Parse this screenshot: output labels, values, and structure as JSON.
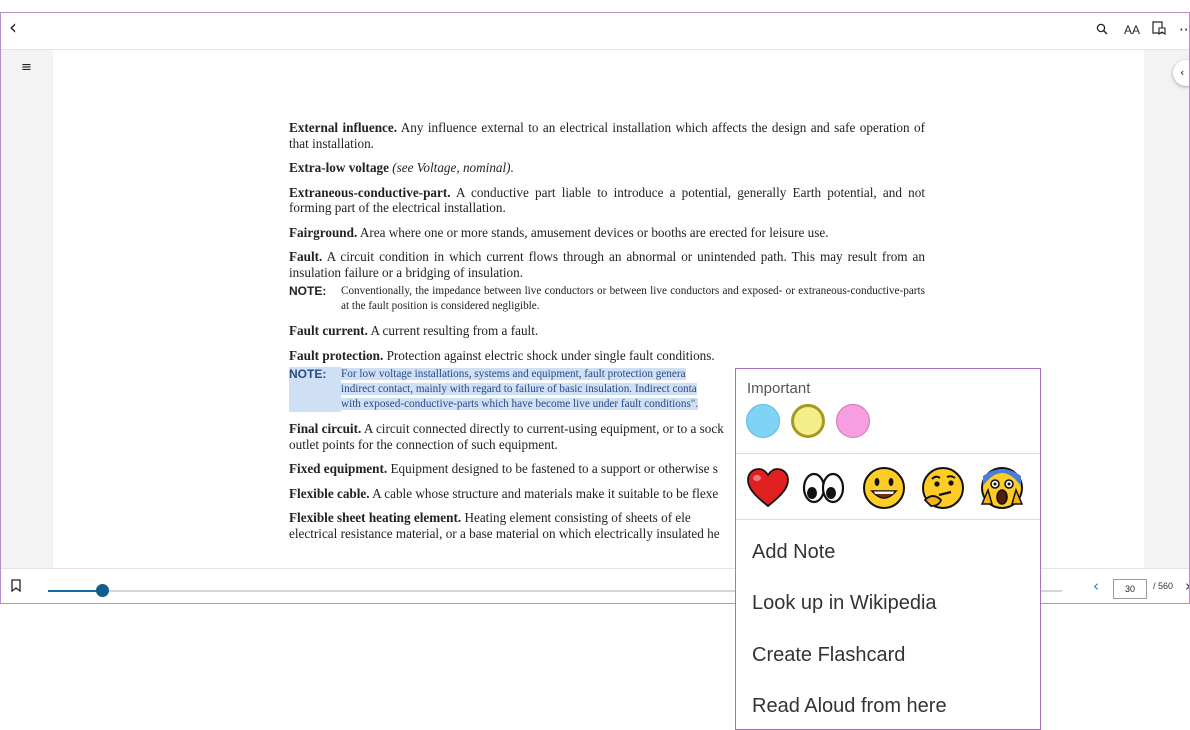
{
  "toolbar": {
    "back_icon": "‹",
    "search_icon": "⌕",
    "text_size_label": "AA",
    "more_icon": "··"
  },
  "sidebar": {
    "toc_icon": "≡"
  },
  "document": {
    "entries": [
      {
        "term": "External influence.",
        "text": " Any influence external to an electrical installation which affects the design and safe operation of that installation."
      },
      {
        "term": "Extra-low voltage",
        "see": " (see Voltage, nominal)."
      },
      {
        "term": "Extraneous-conductive-part.",
        "text": " A conductive part liable to introduce a potential, generally Earth potential, and not forming part of the electrical installation."
      },
      {
        "term": "Fairground.",
        "text": " Area where one or more stands, amusement devices or booths are erected for leisure use."
      },
      {
        "term": "Fault.",
        "text": " A circuit condition in which current flows through an abnormal or unintended path. This may result from an insulation failure or a bridging of insulation."
      },
      {
        "note_label": "NOTE:",
        "note_text": "Conventionally, the impedance between live conductors or between live conductors and exposed- or extraneous-conductive-parts at the fault position is considered negligible."
      },
      {
        "term": "Fault current.",
        "text": " A current resulting from a fault."
      },
      {
        "term": "Fault protection.",
        "text": " Protection against electric shock under single fault conditions."
      },
      {
        "note_label": "NOTE:",
        "note_lines": [
          "For low voltage installations, systems and equipment, fault protection genera",
          "indirect contact, mainly with regard to failure of basic insulation. Indirect conta",
          "with exposed-conductive-parts which have become live under fault conditions\"."
        ]
      },
      {
        "term": "Final circuit.",
        "text": " A circuit connected directly to current-using equipment, or to a sock",
        "text2": "outlet points for the connection of such equipment."
      },
      {
        "term": "Fixed equipment.",
        "text": " Equipment designed to be fastened to a support or otherwise s"
      },
      {
        "term": "Flexible cable.",
        "text": " A cable whose structure and materials make it suitable to be flexe"
      },
      {
        "term": "Flexible sheet heating element.",
        "text": " Heating element consisting of sheets of ele",
        "text2": "electrical resistance material, or a base material on which electrically insulated he"
      }
    ]
  },
  "bottom_bar": {
    "progress": 0.053,
    "current_page": "30",
    "total_pages": "/ 560",
    "prev_icon": "‹",
    "next_icon": "›"
  },
  "popup": {
    "title": "Important",
    "highlight_colors": [
      {
        "name": "blue",
        "fill": "#7fd3f5",
        "border": "#5bb8e0",
        "selected": false
      },
      {
        "name": "yellow",
        "fill": "#f4ee8a",
        "border": "#a6991f",
        "selected": true
      },
      {
        "name": "pink",
        "fill": "#f79ee0",
        "border": "#d86dbf",
        "selected": false
      }
    ],
    "reactions": [
      "heart",
      "eyes",
      "grinning-face",
      "thinking-face",
      "screaming-face"
    ],
    "menu": [
      "Add Note",
      "Look up in Wikipedia",
      "Create Flashcard",
      "Read Aloud from here"
    ]
  }
}
